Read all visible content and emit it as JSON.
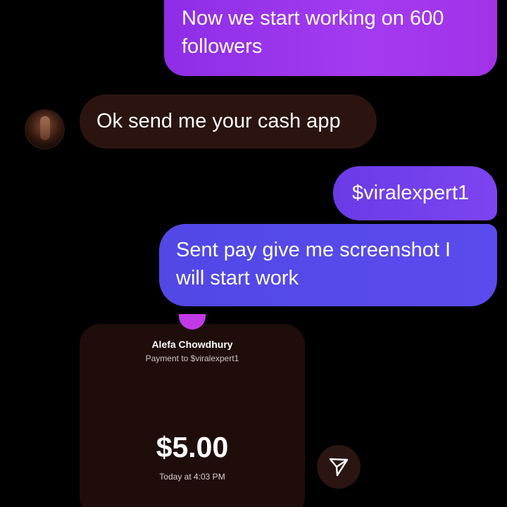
{
  "messages": {
    "sent_1": "Now we start working on 600\nfollowers",
    "received_1": "Ok send me your cash app",
    "sent_2": "$viralexpert1",
    "sent_3": "Sent pay give me screenshot I\nwill start work"
  },
  "payment_card": {
    "name": "Alefa Chowdhury",
    "subtitle": "Payment to $viralexpert1",
    "amount": "$5.00",
    "time": "Today at 4:03 PM"
  },
  "icons": {
    "avatar": "contact-avatar",
    "share": "paper-plane-icon"
  },
  "colors": {
    "background": "#000000",
    "sent_purple": "#a33bf0",
    "sent_violet": "#7d44f0",
    "sent_indigo": "#5b4bee",
    "received_bubble": "#2b1410",
    "card_bg": "#1f0d0c",
    "card_accent": "#c23ae8"
  }
}
